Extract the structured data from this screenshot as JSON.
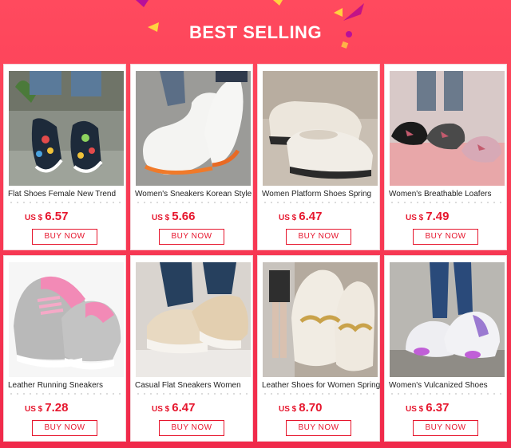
{
  "header": {
    "title": "BEST SELLING"
  },
  "products": [
    {
      "name": "Flat Shoes Female New Trend",
      "currency": "US $",
      "price": "6.57",
      "buy_label": "BUY NOW"
    },
    {
      "name": "Women's Sneakers Korean Style",
      "currency": "US $",
      "price": "5.66",
      "buy_label": "BUY NOW"
    },
    {
      "name": "Women Platform Shoes Spring",
      "currency": "US $",
      "price": "6.47",
      "buy_label": "BUY NOW"
    },
    {
      "name": "Women's Breathable Loafers",
      "currency": "US $",
      "price": "7.49",
      "buy_label": "BUY NOW"
    },
    {
      "name": "Leather Running Sneakers",
      "currency": "US $",
      "price": "7.28",
      "buy_label": "BUY NOW"
    },
    {
      "name": "Casual Flat Sneakers Women",
      "currency": "US $",
      "price": "6.47",
      "buy_label": "BUY NOW"
    },
    {
      "name": "Leather Shoes for Women Spring",
      "currency": "US $",
      "price": "8.70",
      "buy_label": "BUY NOW"
    },
    {
      "name": "Women's Vulcanized Shoes",
      "currency": "US $",
      "price": "6.37",
      "buy_label": "BUY NOW"
    }
  ],
  "colors": {
    "accent": "#e6162d",
    "background": "#f0294a"
  }
}
